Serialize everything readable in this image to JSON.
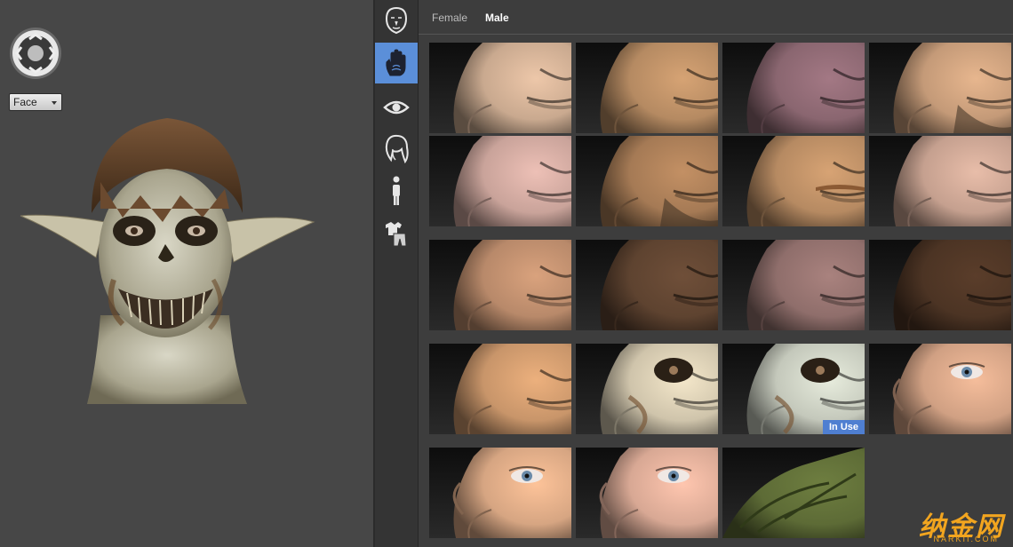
{
  "viewport": {
    "view_select": {
      "value": "Face"
    }
  },
  "rail": {
    "items": [
      {
        "name": "head",
        "icon": "head-icon",
        "active": false
      },
      {
        "name": "skin",
        "icon": "hand-icon",
        "active": true
      },
      {
        "name": "eyes",
        "icon": "eye-icon",
        "active": false
      },
      {
        "name": "hair",
        "icon": "hair-icon",
        "active": false
      },
      {
        "name": "body",
        "icon": "person-icon",
        "active": false
      },
      {
        "name": "clothing",
        "icon": "clothing-icon",
        "active": false
      }
    ]
  },
  "catalog": {
    "tabs": [
      {
        "label": "Female",
        "active": false
      },
      {
        "label": "Male",
        "active": true
      }
    ],
    "in_use_label": "In Use",
    "thumbnails": [
      {
        "skin": "#c9a98f",
        "features": "none"
      },
      {
        "skin": "#b58a62",
        "features": "none"
      },
      {
        "skin": "#8a6670",
        "features": "none"
      },
      {
        "skin": "#c49a78",
        "features": "beard"
      },
      {
        "skin": "#c9a39a",
        "features": "none"
      },
      {
        "skin": "#a57a55",
        "features": "stubble"
      },
      {
        "skin": "#b68a62",
        "features": "mustache"
      },
      {
        "skin": "#c5a08f",
        "features": "none"
      },
      {
        "skin": "#b8896a",
        "features": "none"
      },
      {
        "skin": "#5e4330",
        "features": "none"
      },
      {
        "skin": "#8f6e6b",
        "features": "none"
      },
      {
        "skin": "#4c3424",
        "features": "none"
      },
      {
        "skin": "#c8956a",
        "features": "none"
      },
      {
        "skin": "#cfc4ab",
        "features": "zombie"
      },
      {
        "skin": "#c4c8bb",
        "features": "zombie",
        "in_use": true
      },
      {
        "skin": "#d0a083",
        "features": "eye"
      },
      {
        "skin": "#d6a582",
        "features": "eye"
      },
      {
        "skin": "#d8a894",
        "features": "eye"
      },
      {
        "skin": "#5d6b36",
        "features": "reptile"
      }
    ]
  },
  "watermark": {
    "cn": "纳金网",
    "en": "NARKII.COM"
  },
  "colors": {
    "accent": "#5b8fd9",
    "in_use_badge": "#4f7fd1",
    "rail_bg": "#343434",
    "catalog_bg": "#3d3d3d"
  }
}
